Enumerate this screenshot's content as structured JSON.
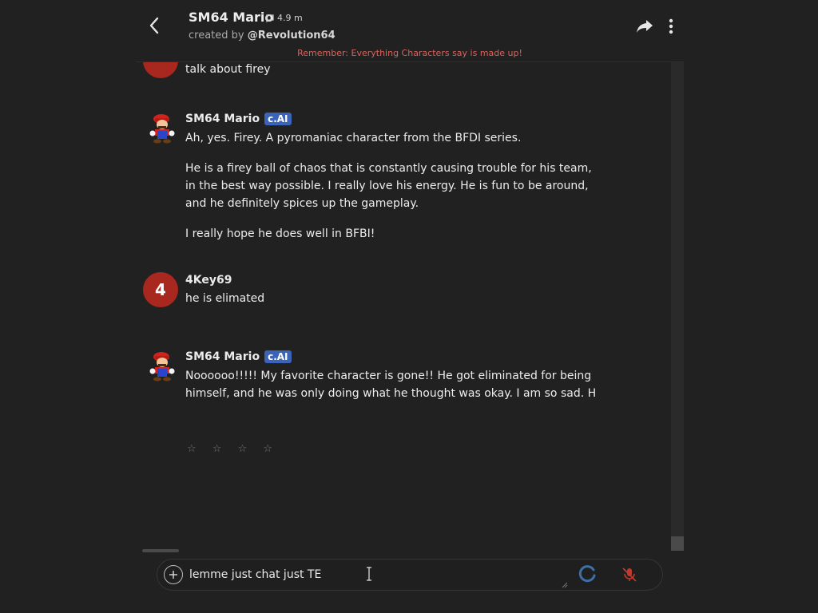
{
  "header": {
    "title": "SM64 Mario",
    "chat_count": "4.9 m",
    "created_by_prefix": "created by",
    "creator": "@Revolution64",
    "reminder": "Remember: Everything Characters say is made up!"
  },
  "messages": [
    {
      "sender": "",
      "text": "talk about firey"
    },
    {
      "sender": "SM64 Mario",
      "badge": "c.AI",
      "paragraphs": [
        "Ah, yes. Firey. A pyromaniac character from the BFDI series.",
        "He is a firey ball of chaos that is constantly causing trouble for his team, in the best way possible. I really love his energy. He is fun to be around, and he definitely spices up the gameplay.",
        "I really hope he does well in BFBI!"
      ]
    },
    {
      "sender": "4Key69",
      "avatar_letter": "4",
      "text": "he is elimated"
    },
    {
      "sender": "SM64 Mario",
      "badge": "c.AI",
      "paragraphs": [
        "Noooooo!!!!! My favorite character is gone!! He got eliminated for being himself, and he was only doing what he thought was okay. I am so sad. H"
      ]
    }
  ],
  "rating": {
    "stars": "☆ ☆ ☆ ☆"
  },
  "input": {
    "value": "lemme just chat just TE"
  },
  "icons": {
    "back": "chevron-left-icon",
    "chats": "chat-bubble-icon",
    "share": "share-arrow-icon",
    "more": "more-vertical-icon",
    "add": "plus-circle-icon",
    "loading": "spinner-icon",
    "mic": "mic-off-icon"
  },
  "colors": {
    "background": "#212121",
    "reminder": "#d9635c",
    "badge": "#3b63b7",
    "user_avatar": "#a8281f",
    "spinner": "#3f6fa7",
    "mic_off": "#c0392b"
  }
}
